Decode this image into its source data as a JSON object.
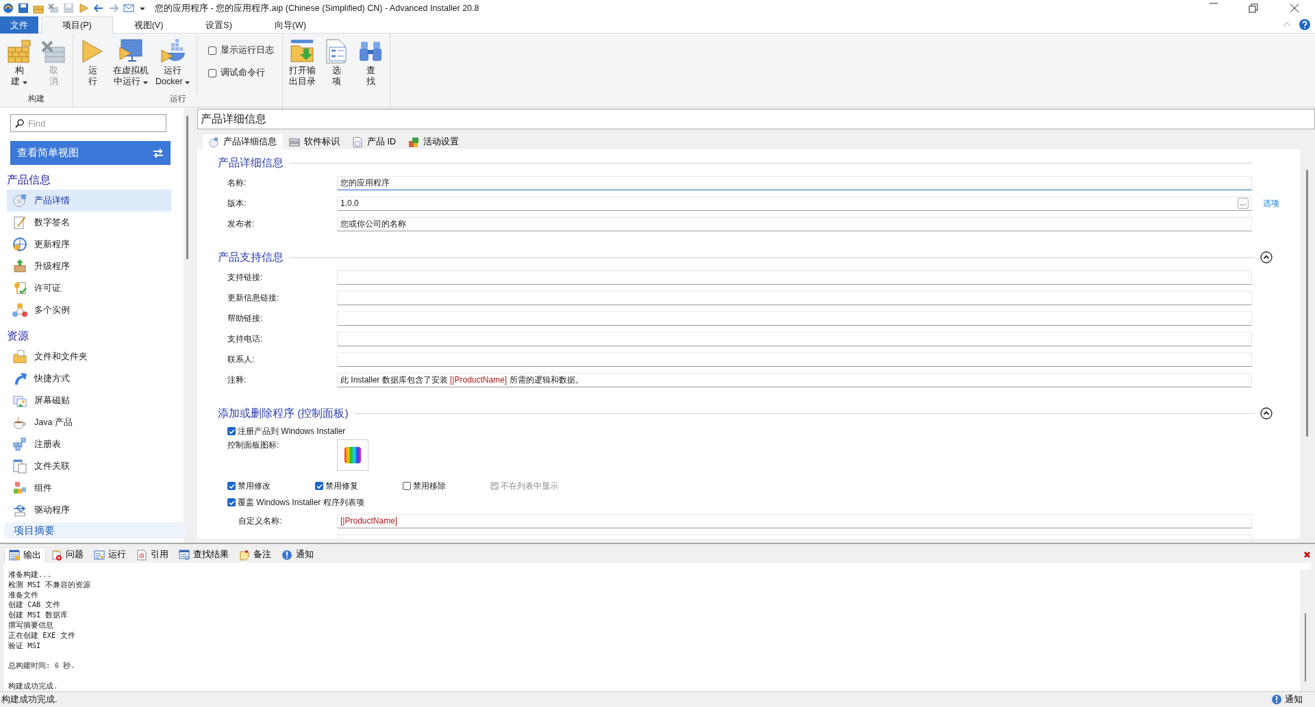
{
  "window": {
    "title": "您的应用程序 - 您的应用程序.aip (Chinese (Simplified) CN) - Advanced Installer 20.8"
  },
  "ribbon_tabs": [
    {
      "label": "文件",
      "kind": "file",
      "selected": false
    },
    {
      "label": "项目(P)",
      "kind": "tab",
      "selected": true
    },
    {
      "label": "视图(V)",
      "kind": "tab",
      "selected": false
    },
    {
      "label": "设置S)",
      "kind": "tab",
      "selected": false
    },
    {
      "label": "向导(W)",
      "kind": "tab",
      "selected": false
    }
  ],
  "ribbon_groups": [
    {
      "label": "构建",
      "items": [
        {
          "kind": "button",
          "lines": [
            "构",
            "建"
          ],
          "dropdown": true,
          "disabled": false
        },
        {
          "kind": "button",
          "lines": [
            "取",
            "消"
          ],
          "dropdown": false,
          "disabled": true
        }
      ]
    },
    {
      "label": "运行",
      "items": [
        {
          "kind": "button",
          "lines": [
            "运",
            "行"
          ],
          "dropdown": false,
          "disabled": false
        },
        {
          "kind": "button",
          "lines": [
            "在虚拟机",
            "中运行"
          ],
          "dropdown": true,
          "disabled": false
        },
        {
          "kind": "button",
          "lines": [
            "运行",
            "Docker"
          ],
          "dropdown": true,
          "disabled": false
        },
        {
          "kind": "checkboxes",
          "boxes": [
            {
              "label": "显示运行日志",
              "checked": false
            },
            {
              "label": "调试命令行",
              "checked": false
            }
          ]
        }
      ]
    },
    {
      "items": [
        {
          "kind": "button",
          "lines": [
            "打开输",
            "出目录"
          ],
          "dropdown": false,
          "disabled": false
        },
        {
          "kind": "button",
          "lines": [
            "选",
            "项"
          ],
          "dropdown": false,
          "disabled": false
        },
        {
          "kind": "button",
          "lines": [
            "查",
            "找"
          ],
          "dropdown": false,
          "disabled": false
        }
      ]
    }
  ],
  "sidebar": {
    "search": {
      "placeholder": "Find"
    },
    "simple_view_button": "查看简单视图",
    "sections": [
      {
        "title": "产品信息",
        "items": [
          {
            "label": "产品详情",
            "selected": true
          },
          {
            "label": "数字签名",
            "selected": false
          },
          {
            "label": "更新程序",
            "selected": false
          },
          {
            "label": "升级程序",
            "selected": false
          },
          {
            "label": "许可证",
            "selected": false
          },
          {
            "label": "多个实例",
            "selected": false
          }
        ]
      },
      {
        "title": "资源",
        "items": [
          {
            "label": "文件和文件夹",
            "selected": false
          },
          {
            "label": "快捷方式",
            "selected": false
          },
          {
            "label": "屏幕磁贴",
            "selected": false
          },
          {
            "label": "Java 产品",
            "selected": false
          },
          {
            "label": "注册表",
            "selected": false
          },
          {
            "label": "文件关联",
            "selected": false
          },
          {
            "label": "组件",
            "selected": false
          },
          {
            "label": "驱动程序",
            "selected": false
          }
        ]
      }
    ],
    "footer": "项目摘要"
  },
  "page": {
    "title": "产品详细信息",
    "tabs": [
      {
        "label": "产品详细信息",
        "selected": true
      },
      {
        "label": "软件标识",
        "selected": false
      },
      {
        "label": "产品 ID",
        "selected": false
      },
      {
        "label": "活动设置",
        "selected": false
      }
    ],
    "sections": [
      {
        "title": "产品详细信息",
        "collapsible": false,
        "items": [
          {
            "kind": "field",
            "label": "名称:",
            "value": "您的应用程序",
            "focused": true
          },
          {
            "kind": "field",
            "label": "版本:",
            "value": "1.0.0",
            "focused": false,
            "browse_button": "...",
            "link": "选项"
          },
          {
            "kind": "field",
            "label": "发布者:",
            "value": "您或你公司的名称",
            "focused": false
          }
        ]
      },
      {
        "title": "产品支持信息",
        "collapsible": true,
        "items": [
          {
            "kind": "field",
            "label": "支持链接:",
            "focused": false
          },
          {
            "kind": "field",
            "label": "更新信息链接:",
            "focused": false
          },
          {
            "kind": "field",
            "label": "帮助链接:",
            "focused": false
          },
          {
            "kind": "field",
            "label": "支持电话:",
            "focused": false
          },
          {
            "kind": "field",
            "label": "联系人:",
            "focused": false
          },
          {
            "kind": "field",
            "label": "注释:",
            "focused": false,
            "parts": [
              {
                "text": "此 Installer 数据库包含了安装 ",
                "kind": "text"
              },
              {
                "text": "[|ProductName]",
                "kind": "property"
              },
              {
                "text": " 所需的逻辑和数据。",
                "kind": "text"
              }
            ]
          }
        ]
      },
      {
        "title": "添加或删除程序 (控制面板)",
        "collapsible": true,
        "items": [
          {
            "kind": "checkbox",
            "label": "注册产品到 Windows Installer",
            "checked": true,
            "disabled": false
          },
          {
            "kind": "icon_picker",
            "label": "控制面板图标:"
          },
          {
            "kind": "checkbox_row",
            "boxes": [
              {
                "label": "禁用修改",
                "checked": true,
                "disabled": false
              },
              {
                "label": "禁用修复",
                "checked": true,
                "disabled": false
              },
              {
                "label": "禁用移除",
                "checked": false,
                "disabled": false
              },
              {
                "label": "不在列表中显示",
                "checked": true,
                "disabled": true
              }
            ]
          },
          {
            "kind": "checkbox",
            "label": "覆盖 Windows Installer 程序列表项",
            "checked": true,
            "disabled": false,
            "children": [
              {
                "kind": "field",
                "label": "自定义名称:",
                "focused": false,
                "parts": [
                  {
                    "text": "[|ProductName]",
                    "kind": "property"
                  }
                ]
              },
              {
                "kind": "field"
              }
            ]
          }
        ]
      }
    ]
  },
  "output": {
    "tabs": [
      {
        "label": "输出",
        "selected": true
      },
      {
        "label": "问题",
        "selected": false
      },
      {
        "label": "运行",
        "selected": false
      },
      {
        "label": "引用",
        "selected": false
      },
      {
        "label": "查找结果",
        "selected": false
      },
      {
        "label": "备注",
        "selected": false
      },
      {
        "label": "通知",
        "selected": false
      }
    ],
    "lines": [
      {
        "text": "准备构建...",
        "kind": "normal"
      },
      {
        "text": "检测 MSI 不兼容的资源",
        "kind": "normal"
      },
      {
        "text": "准备文件",
        "kind": "normal"
      },
      {
        "text": "创建 CAB 文件",
        "kind": "normal"
      },
      {
        "text": "创建 MSI 数据库",
        "kind": "normal"
      },
      {
        "text": "撰写摘要信息",
        "kind": "normal"
      },
      {
        "text": "正在创建 EXE 文件",
        "kind": "normal"
      },
      {
        "text": "验证 MSI",
        "kind": "normal"
      },
      {
        "text": "总构建时间: 6 秒.",
        "kind": "summary"
      },
      {
        "text": "构建成功完成.",
        "kind": "result"
      }
    ]
  },
  "status_bar": {
    "text": "构建成功完成.",
    "notification": "通知"
  }
}
